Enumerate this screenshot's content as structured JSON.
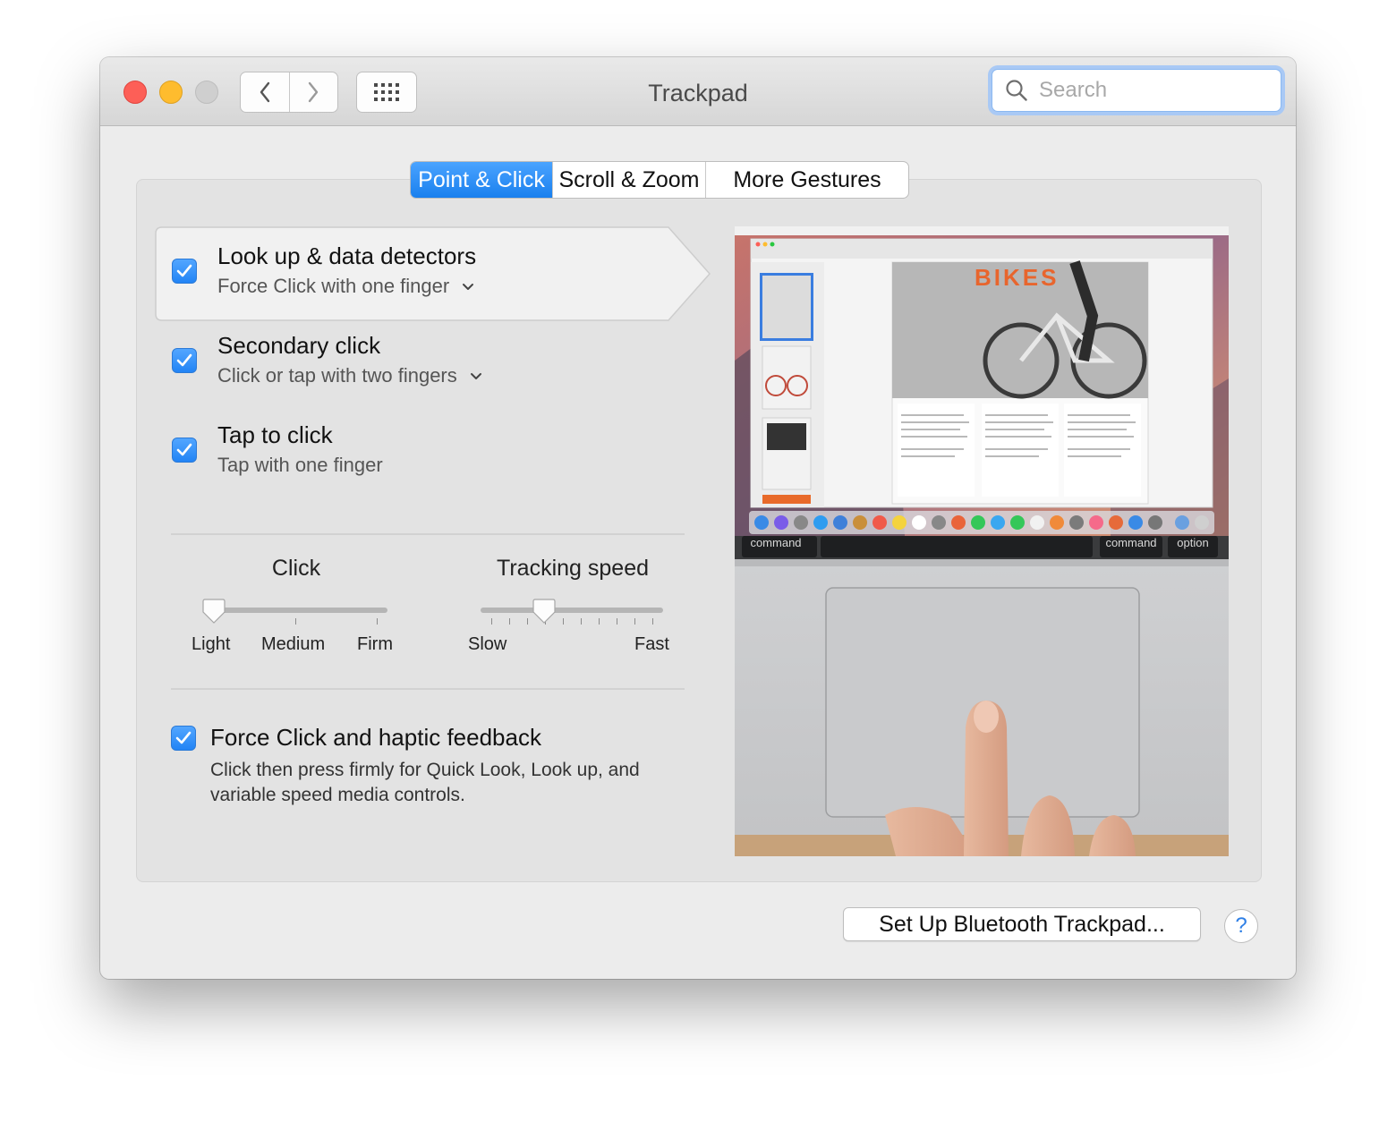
{
  "window": {
    "title": "Trackpad",
    "search_placeholder": "Search"
  },
  "tabs": [
    {
      "label": "Point & Click",
      "active": true
    },
    {
      "label": "Scroll & Zoom",
      "active": false
    },
    {
      "label": "More Gestures",
      "active": false
    }
  ],
  "options": [
    {
      "title": "Look up & data detectors",
      "subtitle": "Force Click with one finger",
      "checked": true,
      "has_menu": true
    },
    {
      "title": "Secondary click",
      "subtitle": "Click or tap with two fingers",
      "checked": true,
      "has_menu": true
    },
    {
      "title": "Tap to click",
      "subtitle": "Tap with one finger",
      "checked": true,
      "has_menu": false
    }
  ],
  "click_slider": {
    "label": "Click",
    "ticks": [
      "Light",
      "Medium",
      "Firm"
    ],
    "value_index": 0
  },
  "tracking_slider": {
    "label": "Tracking speed",
    "min_label": "Slow",
    "max_label": "Fast",
    "value_fraction": 0.35
  },
  "force_click": {
    "title": "Force Click and haptic feedback",
    "description": "Click then press firmly for Quick Look, Look up, and variable speed media controls.",
    "checked": true
  },
  "preview": {
    "doc_title": "BIKES",
    "key_command_left": "command",
    "key_command_right": "command",
    "key_option": "option"
  },
  "footer": {
    "bluetooth_button": "Set Up Bluetooth Trackpad...",
    "help_button": "?"
  },
  "colors": {
    "accent": "#1a80ee",
    "close": "#fd5f57",
    "minimize": "#febc2e",
    "zoom_disabled": "#cfcfcf"
  },
  "icons": [
    "back-chevron-icon",
    "forward-chevron-icon",
    "grid-icon",
    "search-icon",
    "checkmark-icon",
    "chevron-down-icon",
    "help-icon"
  ]
}
